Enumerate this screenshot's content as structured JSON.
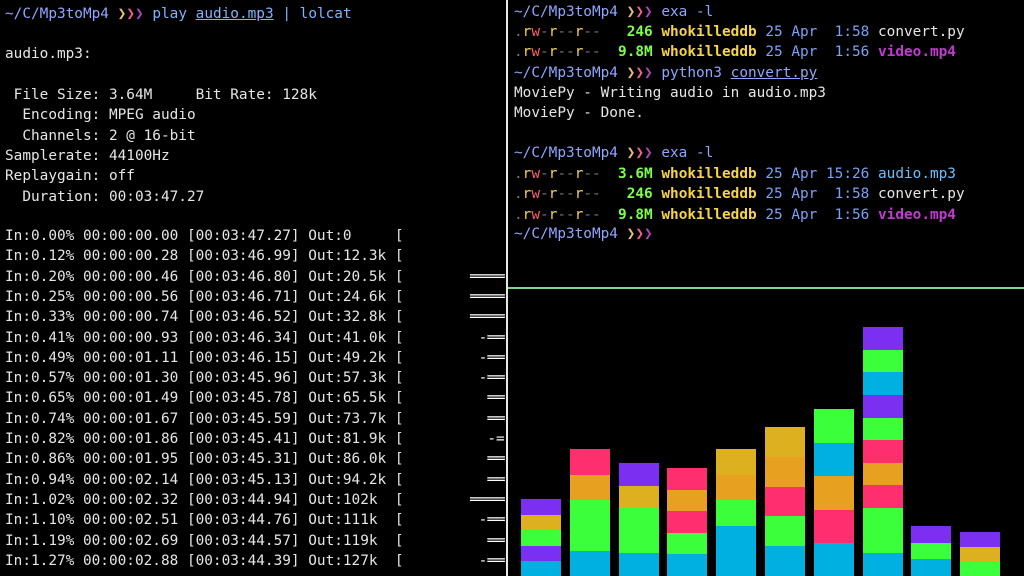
{
  "left": {
    "prompt_path": "~/C/Mp3toMp4",
    "arrows": "❯❯❯",
    "cmd_play": "play",
    "cmd_file": "audio.mp3",
    "cmd_pipe": "|",
    "cmd_lolcat": "lolcat",
    "filename": "audio.mp3:",
    "info": [
      " File Size: 3.64M     Bit Rate: 128k",
      "  Encoding: MPEG audio",
      "  Channels: 2 @ 16-bit",
      "Samplerate: 44100Hz",
      "Replaygain: off",
      "  Duration: 00:03:47.27"
    ],
    "progress": [
      {
        "line": "In:0.00% 00:00:00.00 [00:03:47.27] Out:0     [",
        "wave": ""
      },
      {
        "line": "In:0.12% 00:00:00.28 [00:03:46.99] Out:12.3k [",
        "wave": ""
      },
      {
        "line": "In:0.20% 00:00:00.46 [00:03:46.80] Out:20.5k [",
        "wave": "════"
      },
      {
        "line": "In:0.25% 00:00:00.56 [00:03:46.71] Out:24.6k [",
        "wave": "════"
      },
      {
        "line": "In:0.33% 00:00:00.74 [00:03:46.52] Out:32.8k [",
        "wave": "════"
      },
      {
        "line": "In:0.41% 00:00:00.93 [00:03:46.34] Out:41.0k [",
        "wave": " -══"
      },
      {
        "line": "In:0.49% 00:00:01.11 [00:03:46.15] Out:49.2k [",
        "wave": " -══"
      },
      {
        "line": "In:0.57% 00:00:01.30 [00:03:45.96] Out:57.3k [",
        "wave": " -══"
      },
      {
        "line": "In:0.65% 00:00:01.49 [00:03:45.78] Out:65.5k [",
        "wave": "  ══"
      },
      {
        "line": "In:0.74% 00:00:01.67 [00:03:45.59] Out:73.7k [",
        "wave": "  ══"
      },
      {
        "line": "In:0.82% 00:00:01.86 [00:03:45.41] Out:81.9k [",
        "wave": "  -="
      },
      {
        "line": "In:0.86% 00:00:01.95 [00:03:45.31] Out:86.0k [",
        "wave": "  ══"
      },
      {
        "line": "In:0.94% 00:00:02.14 [00:03:45.13] Out:94.2k [",
        "wave": "  ══"
      },
      {
        "line": "In:1.02% 00:00:02.32 [00:03:44.94] Out:102k  [",
        "wave": "════"
      },
      {
        "line": "In:1.10% 00:00:02.51 [00:03:44.76] Out:111k  [",
        "wave": " -══"
      },
      {
        "line": "In:1.19% 00:00:02.69 [00:03:44.57] Out:119k  [",
        "wave": "  ══"
      },
      {
        "line": "In:1.27% 00:00:02.88 [00:03:44.39] Out:127k  [",
        "wave": " -══"
      }
    ]
  },
  "right_top": {
    "prompt_path": "~/C/Mp3toMp4",
    "arrows": "❯❯❯",
    "cmd1": "exa -l",
    "listing1": [
      {
        "perm": ".rw-r--r--",
        "size": "246",
        "user": "whokilleddb",
        "date": "25 Apr  1:58",
        "name": "convert.py",
        "kind": "py"
      },
      {
        "perm": ".rw-r--r--",
        "size": "9.8M",
        "user": "whokilleddb",
        "date": "25 Apr  1:56",
        "name": "video.mp4",
        "kind": "mp4"
      }
    ],
    "cmd2_prog": "python3",
    "cmd2_arg": "convert.py",
    "out1": "MoviePy - Writing audio in audio.mp3",
    "out2": "MoviePy - Done.",
    "cmd3": "exa -l",
    "listing2": [
      {
        "perm": ".rw-r--r--",
        "size": "3.6M",
        "user": "whokilleddb",
        "date": "25 Apr 15:26",
        "name": "audio.mp3",
        "kind": "mp3"
      },
      {
        "perm": ".rw-r--r--",
        "size": "246",
        "user": "whokilleddb",
        "date": "25 Apr  1:58",
        "name": "convert.py",
        "kind": "py"
      },
      {
        "perm": ".rw-r--r--",
        "size": "9.8M",
        "user": "whokilleddb",
        "date": "25 Apr  1:56",
        "name": "video.mp4",
        "kind": "mp4"
      }
    ]
  },
  "visualizer": {
    "palette": [
      "#00b0e0",
      "#3cff3c",
      "#ff2e6e",
      "#dcb01e",
      "#7b2ff0",
      "#e8a020"
    ],
    "bars": [
      {
        "level": 0.3,
        "colors": [
          "#00b0e0",
          "#7b2ff0",
          "#3cff3c",
          "#dcb01e",
          "#7b2ff0"
        ]
      },
      {
        "level": 0.5,
        "colors": [
          "#00b0e0",
          "#3cff3c",
          "#3cff3c",
          "#e8a020",
          "#ff2e6e"
        ]
      },
      {
        "level": 0.45,
        "colors": [
          "#00b0e0",
          "#3cff3c",
          "#3cff3c",
          "#dcb01e",
          "#7b2ff0"
        ]
      },
      {
        "level": 0.43,
        "colors": [
          "#00b0e0",
          "#3cff3c",
          "#ff2e6e",
          "#e8a020",
          "#ff2e6e"
        ]
      },
      {
        "level": 0.5,
        "colors": [
          "#00b0e0",
          "#00b0e0",
          "#3cff3c",
          "#e8a020",
          "#dcb01e"
        ]
      },
      {
        "level": 0.59,
        "colors": [
          "#00b0e0",
          "#3cff3c",
          "#ff2e6e",
          "#e8a020",
          "#dcb01e"
        ]
      },
      {
        "level": 0.66,
        "colors": [
          "#00b0e0",
          "#ff2e6e",
          "#e8a020",
          "#00b0e0",
          "#3cff3c"
        ]
      },
      {
        "level": 0.99,
        "colors": [
          "#00b0e0",
          "#3cff3c",
          "#3cff3c",
          "#ff2e6e",
          "#e8a020",
          "#ff2e6e",
          "#3cff3c",
          "#7b2ff0",
          "#00b0e0",
          "#3cff3c",
          "#7b2ff0"
        ]
      },
      {
        "level": 0.2,
        "colors": [
          "#00b0e0",
          "#3cff3c",
          "#7b2ff0"
        ]
      },
      {
        "level": 0.17,
        "colors": [
          "#3cff3c",
          "#dcb01e",
          "#7b2ff0"
        ]
      }
    ]
  }
}
